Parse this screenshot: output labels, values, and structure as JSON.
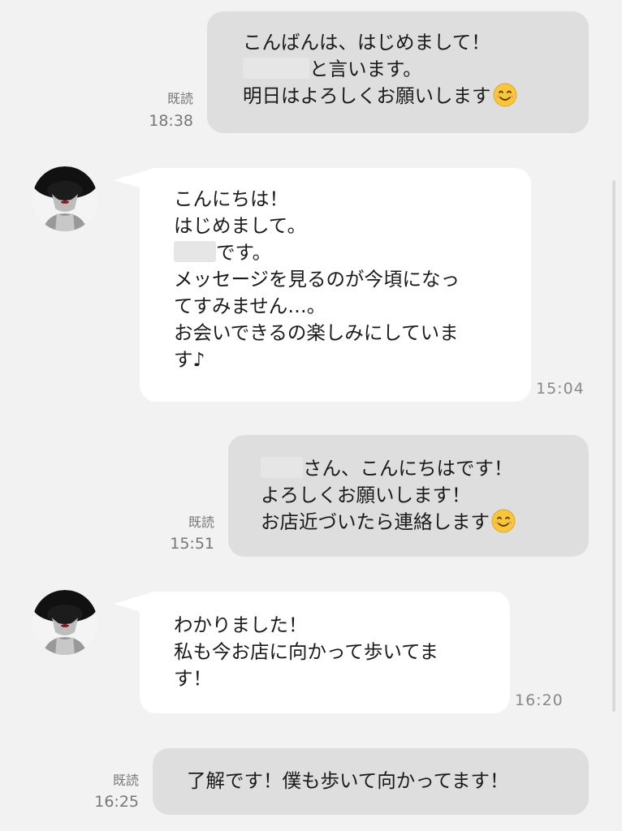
{
  "messages": [
    {
      "direction": "out",
      "read_label": "既読",
      "time": "18:38",
      "lines": [
        {
          "pre": "",
          "redacted": false,
          "text": "こんばんは、はじめまして！"
        },
        {
          "pre": "",
          "redacted": true,
          "text": "と言います。"
        },
        {
          "pre": "",
          "redacted": false,
          "text": "明日はよろしくお願いします",
          "emoji": "smiling-face-emoji"
        }
      ]
    },
    {
      "direction": "in",
      "time": "15:04",
      "lines": [
        {
          "text": "こんにちは！"
        },
        {
          "text": "はじめまして。"
        },
        {
          "redacted": true,
          "text": "です。"
        },
        {
          "text": "メッセージを見るのが今頃になっ"
        },
        {
          "text": "てすみません…。"
        },
        {
          "text": "お会いできるの楽しみにしていま"
        },
        {
          "text": "す♪"
        }
      ]
    },
    {
      "direction": "out",
      "read_label": "既読",
      "time": "15:51",
      "lines": [
        {
          "redacted": true,
          "text": "さん、こんにちはです！"
        },
        {
          "text": "よろしくお願いします！"
        },
        {
          "text": "お店近づいたら連絡します",
          "emoji": "smiling-face-emoji"
        }
      ]
    },
    {
      "direction": "in",
      "time": "16:20",
      "lines": [
        {
          "text": "わかりました！"
        },
        {
          "text": "私も今お店に向かって歩いてま"
        },
        {
          "text": "す！"
        }
      ]
    },
    {
      "direction": "out",
      "read_label": "既読",
      "time": "16:25",
      "lines": [
        {
          "text": "了解です！僕も歩いて向かってます！"
        }
      ]
    }
  ],
  "colors": {
    "background": "#f2f2f2",
    "outgoing_bubble": "#dedede",
    "incoming_bubble": "#ffffff",
    "meta_text": "#777777"
  }
}
